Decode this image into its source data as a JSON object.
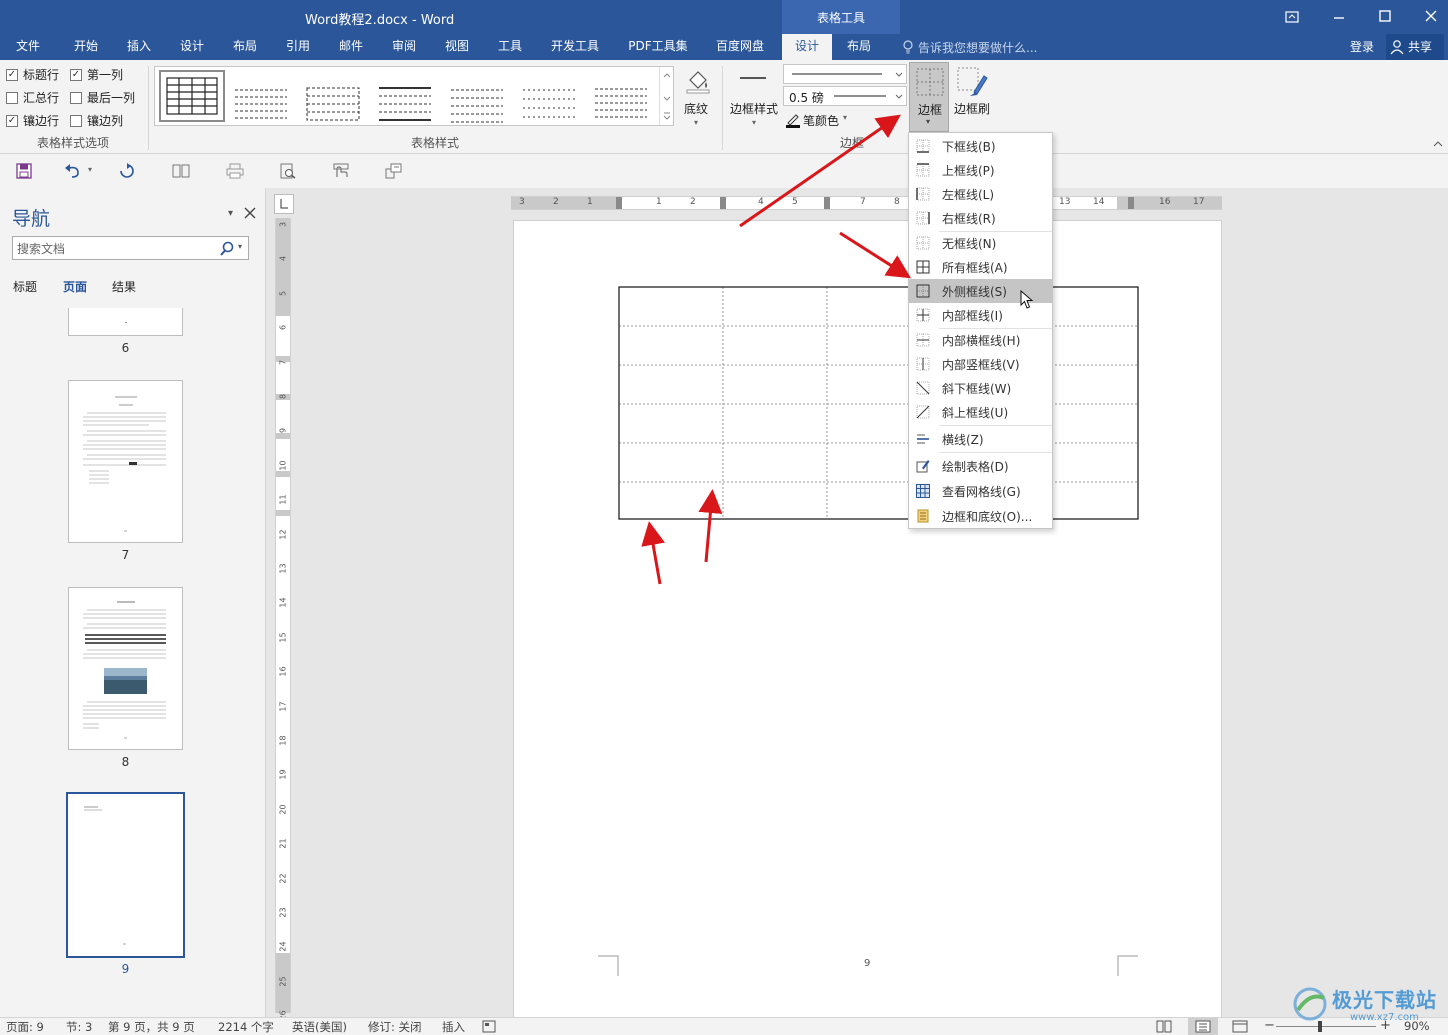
{
  "window": {
    "title": "Word教程2.docx - Word",
    "context_group": "表格工具",
    "controls": [
      "ribbon-display-icon",
      "minimize-icon",
      "maximize-icon",
      "close-icon"
    ]
  },
  "tabs": [
    "文件",
    "开始",
    "插入",
    "设计",
    "布局",
    "引用",
    "邮件",
    "审阅",
    "视图",
    "工具",
    "开发工具",
    "PDF工具集",
    "百度网盘"
  ],
  "context_tabs": [
    "设计",
    "布局"
  ],
  "tell_me": "告诉我您想要做什么...",
  "account": {
    "login": "登录",
    "share": "共享"
  },
  "ribbon": {
    "style_options": {
      "checkboxes": [
        {
          "label": "标题行",
          "checked": true
        },
        {
          "label": "第一列",
          "checked": true
        },
        {
          "label": "汇总行",
          "checked": false
        },
        {
          "label": "最后一列",
          "checked": false
        },
        {
          "label": "镶边行",
          "checked": true
        },
        {
          "label": "镶边列",
          "checked": false
        }
      ],
      "group_label": "表格样式选项"
    },
    "table_styles": {
      "group_label": "表格样式",
      "shading": "底纹"
    },
    "borders": {
      "border_styles": "边框样式",
      "weight": "0.5 磅",
      "pen_color": "笔颜色",
      "borders": "边框",
      "border_painter": "边框刷",
      "group_label": "边框"
    }
  },
  "nav": {
    "title": "导航",
    "search_placeholder": "搜索文档",
    "tabs": [
      "标题",
      "页面",
      "结果"
    ],
    "active_tab": "页面",
    "pages": [
      "6",
      "7",
      "8",
      "9"
    ]
  },
  "page_footer_number": "9",
  "menu": {
    "items": [
      "下框线(B)",
      "上框线(P)",
      "左框线(L)",
      "右框线(R)",
      "无框线(N)",
      "所有框线(A)",
      "外侧框线(S)",
      "内部框线(I)",
      "内部横框线(H)",
      "内部竖框线(V)",
      "斜下框线(W)",
      "斜上框线(U)",
      "横线(Z)",
      "绘制表格(D)",
      "查看网格线(G)",
      "边框和底纹(O)..."
    ],
    "highlighted": "外侧框线(S)"
  },
  "status": {
    "page": "页面: 9",
    "section": "节: 3",
    "page_of": "第 9 页，共 9 页",
    "words": "2214 个字",
    "language": "英语(美国)",
    "track": "修订: 关闭",
    "mode": "插入",
    "zoom": "90%"
  },
  "ruler_numbers": [
    "3",
    "2",
    "1",
    "1",
    "2",
    "4",
    "5",
    "7",
    "8",
    "13",
    "14",
    "16",
    "17"
  ],
  "vruler_numbers": [
    "3",
    "4",
    "5",
    "6",
    "7",
    "8",
    "9",
    "10",
    "11",
    "12",
    "13",
    "14",
    "15",
    "16",
    "17",
    "18",
    "19",
    "20",
    "21",
    "22",
    "23",
    "24",
    "25",
    "26"
  ],
  "watermark": "极光下载站",
  "watermark_url": "www.xz7.com",
  "colors": {
    "brand": "#2b579a",
    "arrow": "#d9171b",
    "highlight": "#c5c5c5"
  }
}
